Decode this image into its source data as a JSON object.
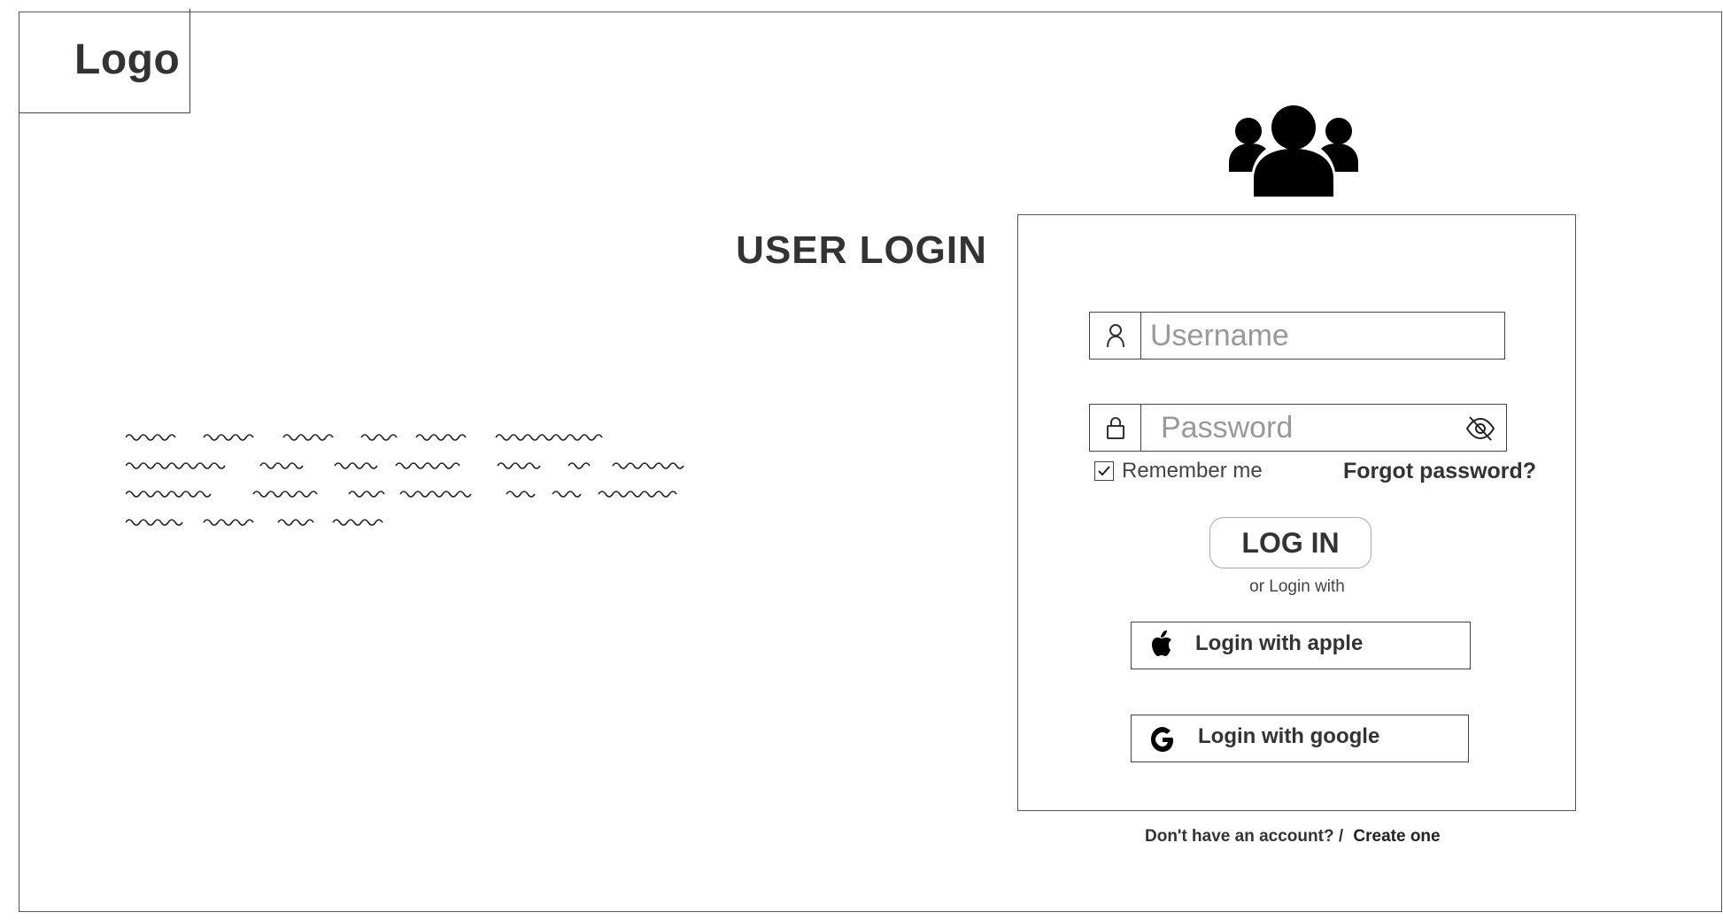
{
  "logo": {
    "text": "Logo"
  },
  "login": {
    "title": "USER LOGIN",
    "username": {
      "placeholder": "Username",
      "icon": "user-icon"
    },
    "password": {
      "placeholder": "Password",
      "icon": "lock-icon",
      "toggle_icon": "eye-off-icon"
    },
    "remember_label": "Remember me",
    "remember_checked": true,
    "forgot_label": "Forgot password?",
    "login_button": "LOG IN",
    "or_text": "or Login with",
    "apple_label": "Login with apple",
    "google_label": "Login with google"
  },
  "footer": {
    "prompt": "Don't have an account? /",
    "create_label": "Create one"
  },
  "colors": {
    "text": "#333333",
    "border": "#444444"
  }
}
